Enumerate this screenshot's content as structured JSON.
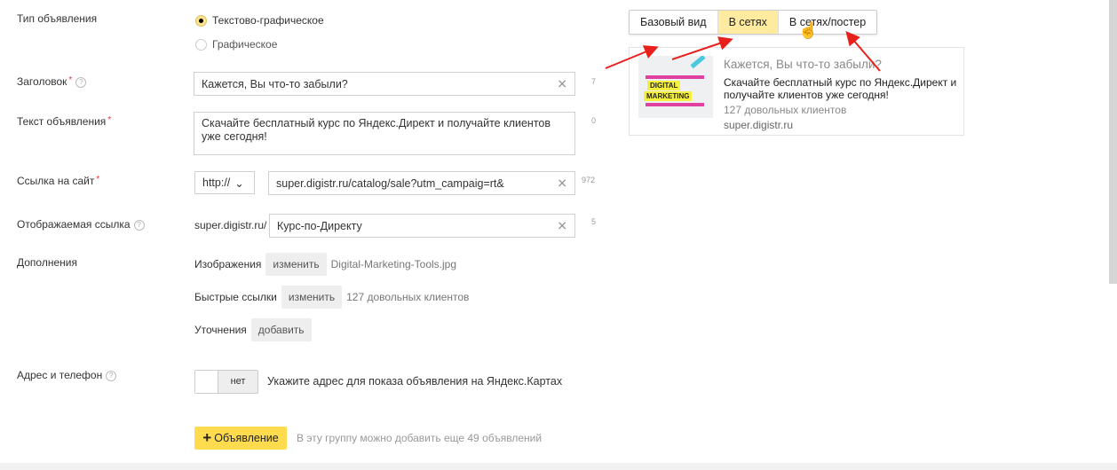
{
  "form": {
    "ad_type": {
      "label": "Тип объявления",
      "options": [
        "Текстово-графическое",
        "Графическое"
      ],
      "selected": 0
    },
    "title": {
      "label": "Заголовок",
      "value": "Кажется, Вы что-то забыли?",
      "counter": "7"
    },
    "text": {
      "label": "Текст объявления",
      "value": "Скачайте бесплатный курс по Яндекс.Директ и получайте клиентов уже сегодня!",
      "counter": "0"
    },
    "url": {
      "label": "Ссылка на сайт",
      "protocol": "http://",
      "value": "super.digistr.ru/catalog/sale?utm_campaig=rt&",
      "counter": "972"
    },
    "display_url": {
      "label": "Отображаемая ссылка",
      "prefix": "super.digistr.ru/",
      "value": "Курс-по-Директу",
      "counter": "5"
    },
    "extras": {
      "label": "Дополнения",
      "images": {
        "label": "Изображения",
        "button": "изменить",
        "value": "Digital-Marketing-Tools.jpg"
      },
      "sitelinks": {
        "label": "Быстрые ссылки",
        "button": "изменить",
        "value": "127 довольных клиентов"
      },
      "callouts": {
        "label": "Уточнения",
        "button": "добавить"
      }
    },
    "address": {
      "label": "Адрес и телефон",
      "toggle": "нет",
      "hint": "Укажите адрес для показа объявления на Яндекс.Картах"
    },
    "add_ad": {
      "button": "Объявление",
      "hint": "В эту группу можно добавить еще 49 объявлений"
    }
  },
  "preview": {
    "tabs": [
      "Базовый вид",
      "В сетях",
      "В сетях/постер"
    ],
    "active_tab": 1,
    "image_text": [
      "DIGITAL",
      "MARKETING"
    ],
    "title": "Кажется, Вы что-то забыли?",
    "text": "Скачайте бесплатный курс по Яндекс.Директ и получайте клиентов уже сегодня!",
    "sitelinks": "127 довольных клиентов",
    "domain": "super.digistr.ru"
  },
  "colors": {
    "accent": "#ffdb4d",
    "active_tab": "#ffeba0",
    "arrow": "#e8201c"
  }
}
